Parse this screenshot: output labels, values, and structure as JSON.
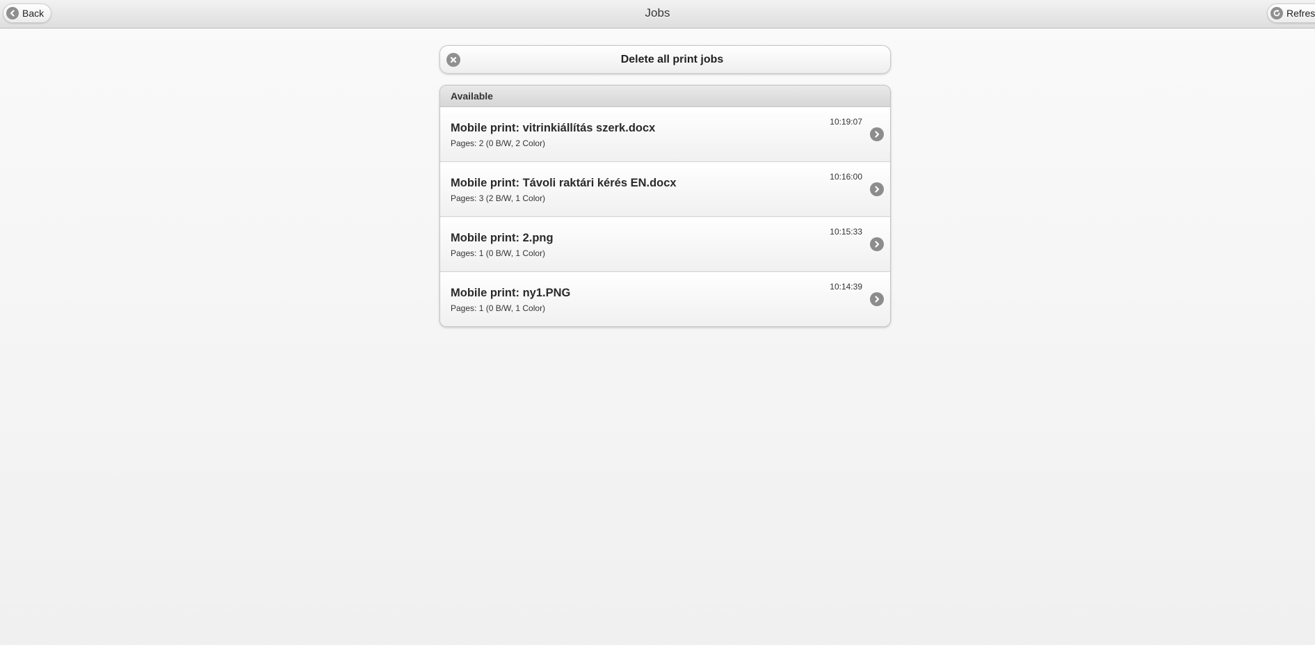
{
  "header": {
    "title": "Jobs",
    "back_label": "Back",
    "refresh_label": "Refresh"
  },
  "actions": {
    "delete_all_label": "Delete all print jobs"
  },
  "jobs_list": {
    "section_label": "Available",
    "items": [
      {
        "title": "Mobile print: vitrinkiállítás szerk.docx",
        "pages": "Pages: 2 (0 B/W, 2 Color)",
        "time": "10:19:07"
      },
      {
        "title": "Mobile print: Távoli raktári kérés EN.docx",
        "pages": "Pages: 3 (2 B/W, 1 Color)",
        "time": "10:16:00"
      },
      {
        "title": "Mobile print: 2.png",
        "pages": "Pages: 1 (0 B/W, 1 Color)",
        "time": "10:15:33"
      },
      {
        "title": "Mobile print: ny1.PNG",
        "pages": "Pages: 1 (0 B/W, 1 Color)",
        "time": "10:14:39"
      }
    ]
  },
  "icons": {
    "back": "arrow-left-icon",
    "refresh": "refresh-icon",
    "delete": "close-icon",
    "row_arrow": "chevron-right-icon"
  },
  "colors": {
    "icon_gray": "#8f8f8f",
    "background": "#f5f5f5"
  }
}
